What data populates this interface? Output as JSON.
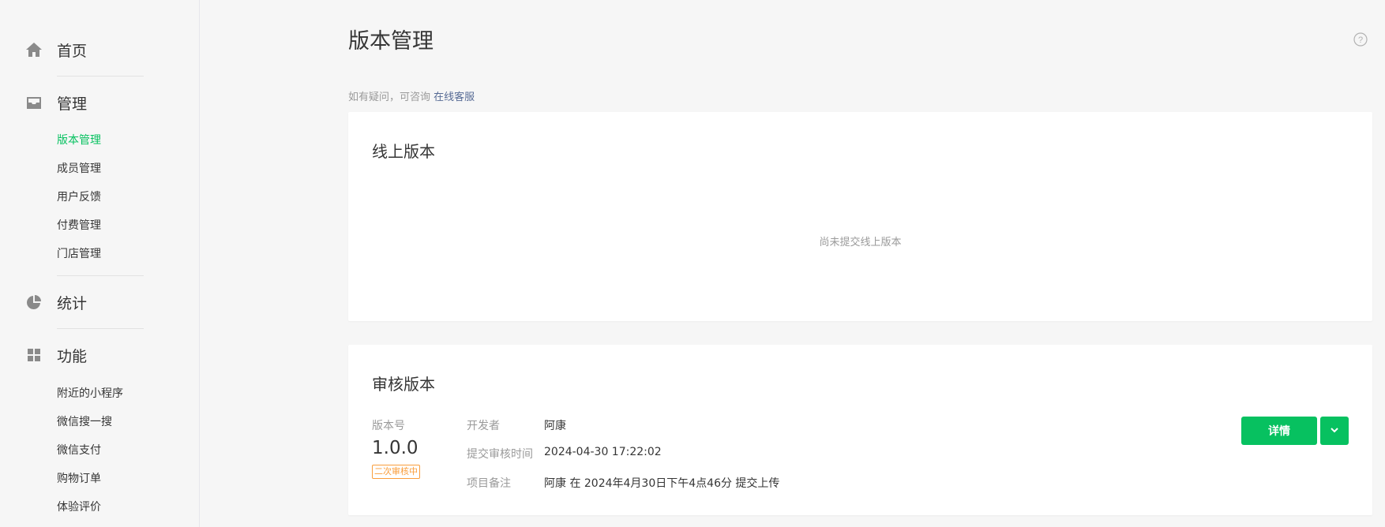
{
  "sidebar": {
    "home": {
      "label": "首页",
      "icon": "home-icon"
    },
    "manage": {
      "label": "管理",
      "icon": "inbox-icon",
      "items": [
        "版本管理",
        "成员管理",
        "用户反馈",
        "付费管理",
        "门店管理"
      ],
      "active_index": 0
    },
    "stats": {
      "label": "统计",
      "icon": "pie-chart-icon"
    },
    "features": {
      "label": "功能",
      "icon": "grid-icon",
      "items": [
        "附近的小程序",
        "微信搜一搜",
        "微信支付",
        "购物订单",
        "体验评价"
      ]
    }
  },
  "page": {
    "title": "版本管理",
    "help_icon": "question-circle-icon",
    "consult_text": "如有疑问，可咨询",
    "consult_link": "在线客服"
  },
  "online": {
    "title": "线上版本",
    "empty_text": "尚未提交线上版本"
  },
  "review": {
    "title": "审核版本",
    "version_label": "版本号",
    "version": "1.0.0",
    "status": "二次审核中",
    "developer_label": "开发者",
    "developer": "阿康",
    "submit_time_label": "提交审核时间",
    "submit_time": "2024-04-30 17:22:02",
    "remark_label": "项目备注",
    "remark": "阿康 在 2024年4月30日下午4点46分 提交上传",
    "detail_button": "详情",
    "more_icon": "chevron-down-icon"
  },
  "colors": {
    "accent": "#07c160",
    "link": "#576b95",
    "warning": "#fa9d3b"
  }
}
